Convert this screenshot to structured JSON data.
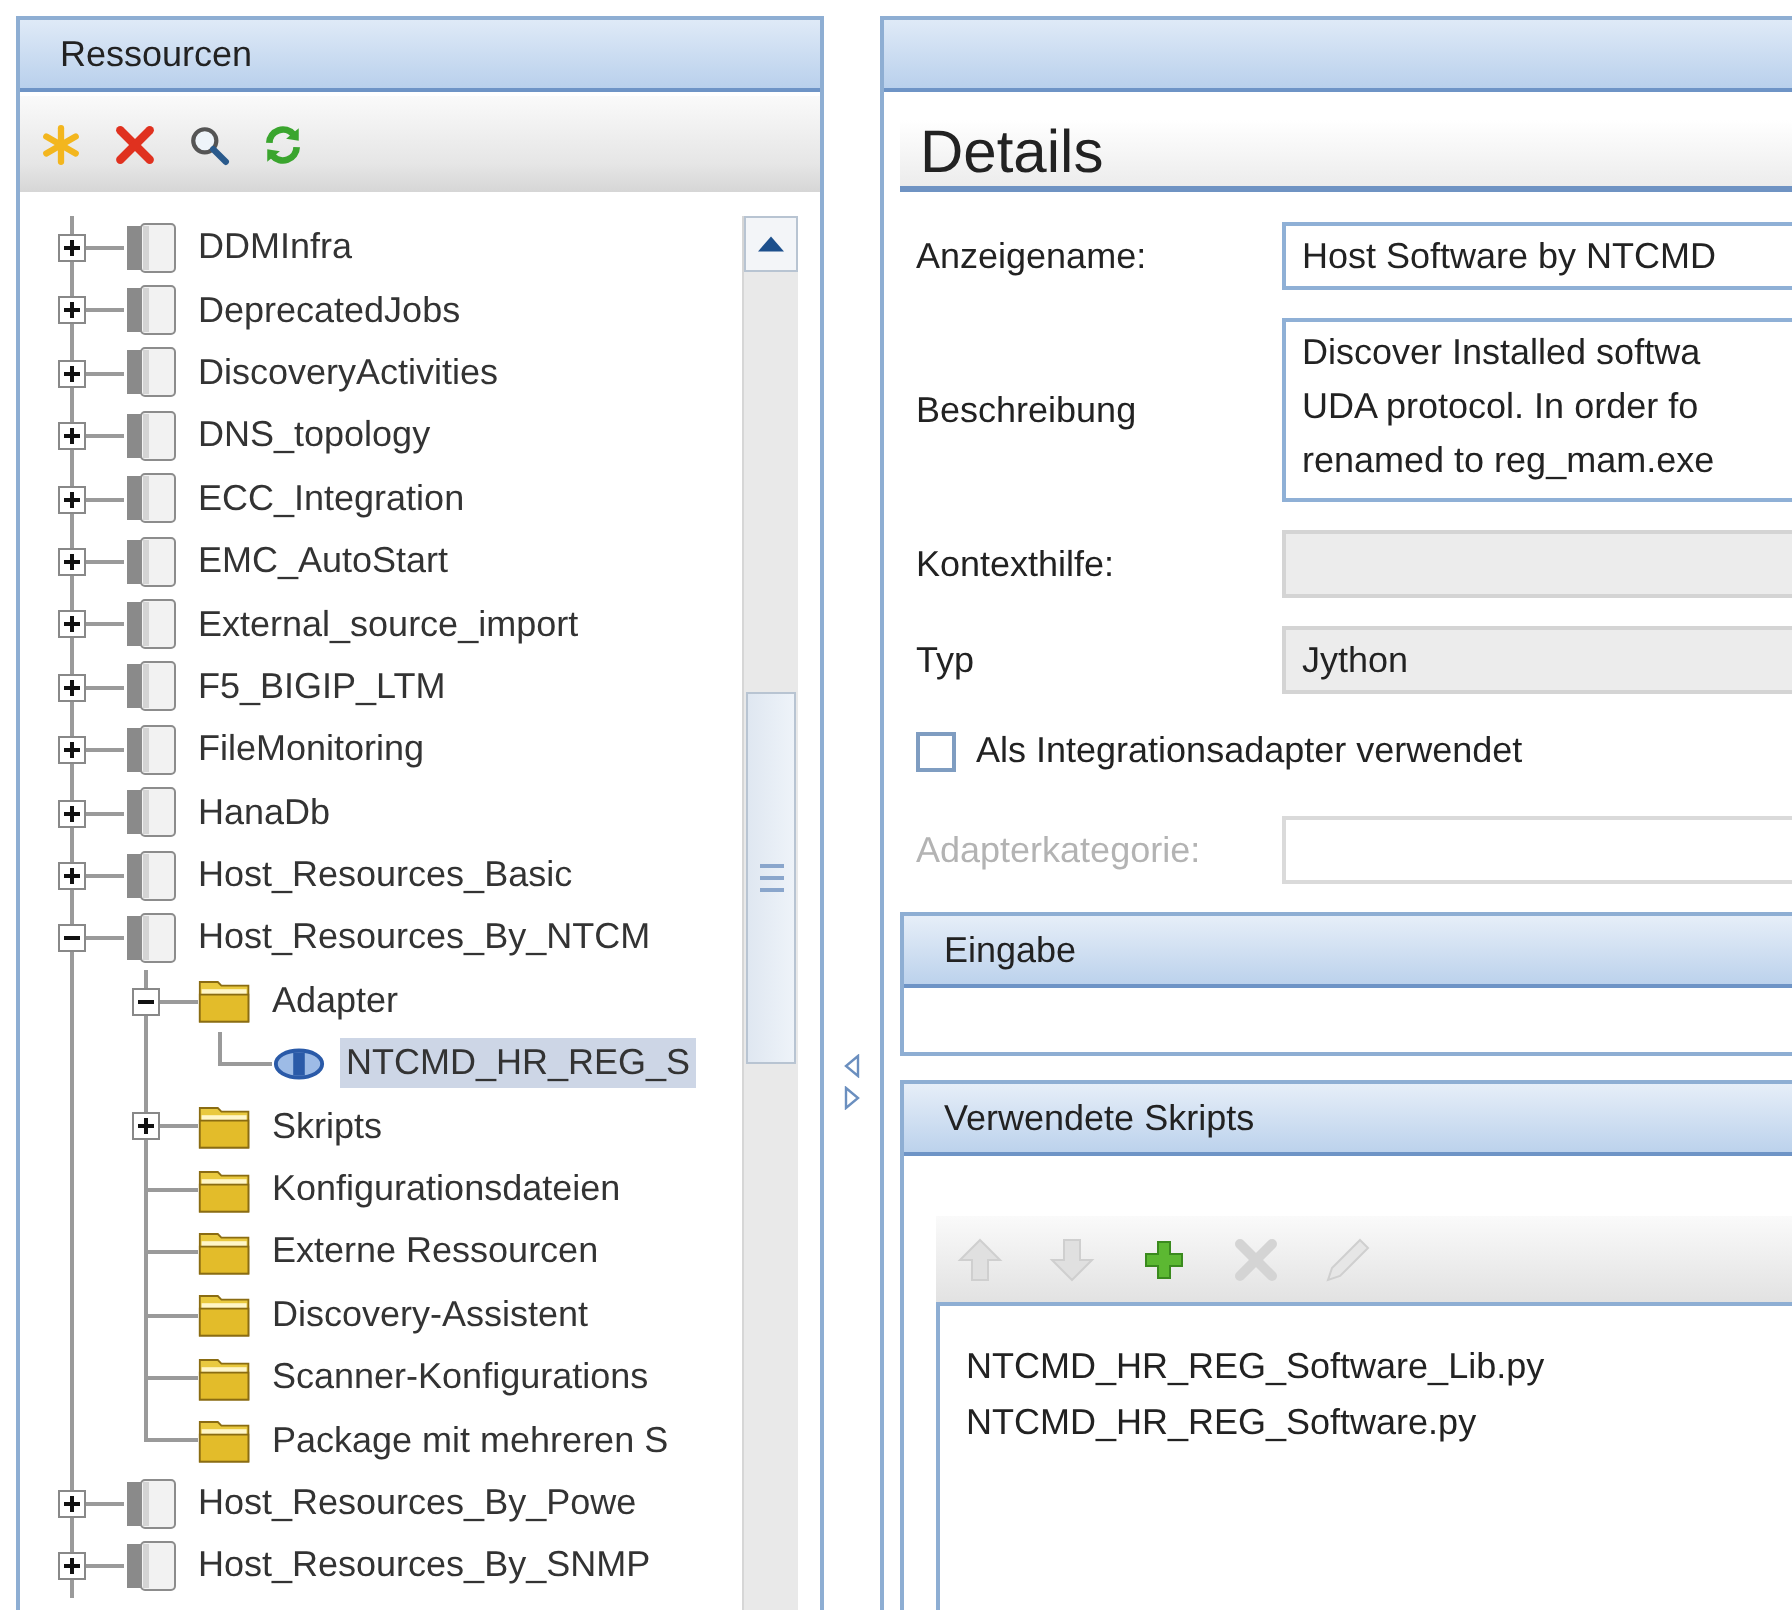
{
  "resources_panel": {
    "title": "Ressourcen",
    "tree": [
      {
        "label": "DDMInfra",
        "kind": "package",
        "expanded": false,
        "selected": false
      },
      {
        "label": "DeprecatedJobs",
        "kind": "package",
        "expanded": false,
        "selected": false
      },
      {
        "label": "DiscoveryActivities",
        "kind": "package",
        "expanded": false,
        "selected": false
      },
      {
        "label": "DNS_topology",
        "kind": "package",
        "expanded": false,
        "selected": false
      },
      {
        "label": "ECC_Integration",
        "kind": "package",
        "expanded": false,
        "selected": false
      },
      {
        "label": "EMC_AutoStart",
        "kind": "package",
        "expanded": false,
        "selected": false
      },
      {
        "label": "External_source_import",
        "kind": "package",
        "expanded": false,
        "selected": false
      },
      {
        "label": "F5_BIGIP_LTM",
        "kind": "package",
        "expanded": false,
        "selected": false
      },
      {
        "label": "FileMonitoring",
        "kind": "package",
        "expanded": false,
        "selected": false
      },
      {
        "label": "HanaDb",
        "kind": "package",
        "expanded": false,
        "selected": false
      },
      {
        "label": "Host_Resources_Basic",
        "kind": "package",
        "expanded": false,
        "selected": false
      },
      {
        "label": "Host_Resources_By_NTCM",
        "kind": "package",
        "expanded": true,
        "selected": false,
        "children": [
          {
            "label": "Adapter",
            "kind": "folder",
            "expanded": true,
            "selected": false,
            "children": [
              {
                "label": "NTCMD_HR_REG_S",
                "kind": "adapter",
                "selected": true
              }
            ]
          },
          {
            "label": "Skripts",
            "kind": "folder",
            "expanded": false,
            "selected": false
          },
          {
            "label": "Konfigurationsdateien",
            "kind": "folder",
            "selected": false
          },
          {
            "label": "Externe Ressourcen",
            "kind": "folder",
            "selected": false
          },
          {
            "label": "Discovery-Assistent",
            "kind": "folder",
            "selected": false
          },
          {
            "label": "Scanner-Konfigurations",
            "kind": "folder",
            "selected": false
          },
          {
            "label": "Package mit mehreren S",
            "kind": "folder",
            "selected": false
          }
        ]
      },
      {
        "label": "Host_Resources_By_Powe",
        "kind": "package",
        "expanded": false,
        "selected": false
      },
      {
        "label": "Host_Resources_By_SNMP",
        "kind": "package",
        "expanded": false,
        "selected": false
      }
    ]
  },
  "details": {
    "heading": "Details",
    "fields": [
      {
        "kind": "text",
        "label": "Anzeigename:",
        "value": "Host Software by NTCMD",
        "readonly": false,
        "disabled": false
      },
      {
        "kind": "textarea",
        "label": "Beschreibung",
        "lines": [
          "Discover Installed softwa",
          "UDA protocol. In order fo",
          "renamed to reg_mam.exe"
        ],
        "readonly": false,
        "disabled": false
      },
      {
        "kind": "text",
        "label": "Kontexthilfe:",
        "readonly": true,
        "disabled": false
      },
      {
        "kind": "text",
        "label": "Typ",
        "value": "Jython",
        "readonly": true,
        "disabled": false
      },
      {
        "kind": "checkbox",
        "label": "Als Integrationsadapter verwendet",
        "checked": false
      },
      {
        "kind": "text",
        "label": "Adapterkategorie:",
        "readonly": false,
        "disabled": true
      }
    ],
    "sections": [
      {
        "kind": "empty",
        "title": "Eingabe"
      },
      {
        "kind": "scripts",
        "title": "Verwendete Skripts",
        "scripts": [
          "NTCMD_HR_REG_Software_Lib.py",
          "NTCMD_HR_REG_Software.py"
        ]
      }
    ]
  }
}
